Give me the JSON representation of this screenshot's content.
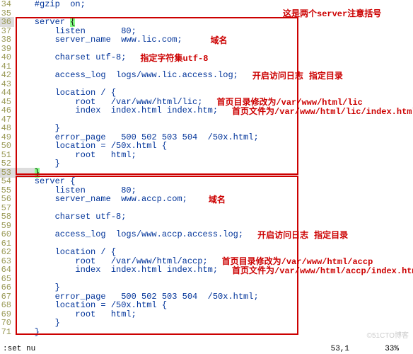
{
  "annotations": {
    "header_note": "这是两个server注意括号",
    "domain": "域名",
    "charset": "指定字符集utf-8",
    "log_on": "开启访问日志",
    "log_dir": "指定目录",
    "root1": "首页目录修改为/var/www/html/lic",
    "index1": "首页文件为/var/www/html/lic/index.html",
    "root2": "首页目录修改为/var/www/html/accp",
    "index2": "首页文件为/var/www/html/accp/index.html"
  },
  "lines": {
    "34": "    #gzip  on;",
    "35": "",
    "36a": "    server ",
    "36b": "{",
    "37": "        listen       80;",
    "38": "        server_name  www.lic.com;",
    "39": "",
    "40": "        charset utf-8;",
    "41": "",
    "42": "        access_log  logs/www.lic.access.log;",
    "43": "",
    "44": "        location / {",
    "45": "            root   /var/www/html/lic;",
    "46": "            index  index.html index.htm;",
    "47": "",
    "48": "        }",
    "49": "        error_page   500 502 503 504  /50x.html;",
    "50": "        location = /50x.html {",
    "51": "            root   html;",
    "52": "        }",
    "53a": "    ",
    "53b": "}",
    "54": "    server {",
    "55": "        listen       80;",
    "56": "        server_name  www.accp.com;",
    "57": "",
    "58": "        charset utf-8;",
    "59": "",
    "60": "        access_log  logs/www.accp.access.log;",
    "61": "",
    "62": "        location / {",
    "63": "            root   /var/www/html/accp;",
    "64": "            index  index.html index.htm;",
    "65": "",
    "66": "        }",
    "67": "        error_page   500 502 503 504  /50x.html;",
    "68": "        location = /50x.html {",
    "69": "            root   html;",
    "70": "        }",
    "71": "    }"
  },
  "linenums": {
    "34": "34",
    "35": "35",
    "36": "36",
    "37": "37",
    "38": "38",
    "39": "39",
    "40": "40",
    "41": "41",
    "42": "42",
    "43": "43",
    "44": "44",
    "45": "45",
    "46": "46",
    "47": "47",
    "48": "48",
    "49": "49",
    "50": "50",
    "51": "51",
    "52": "52",
    "53": "53",
    "54": "54",
    "55": "55",
    "56": "56",
    "57": "57",
    "58": "58",
    "59": "59",
    "60": "60",
    "61": "61",
    "62": "62",
    "63": "63",
    "64": "64",
    "65": "65",
    "66": "66",
    "67": "67",
    "68": "68",
    "69": "69",
    "70": "70",
    "71": "71"
  },
  "status": {
    "cmd": ":set nu",
    "pos": "53,1",
    "pct": "33%"
  },
  "watermark": "©51CTO博客"
}
